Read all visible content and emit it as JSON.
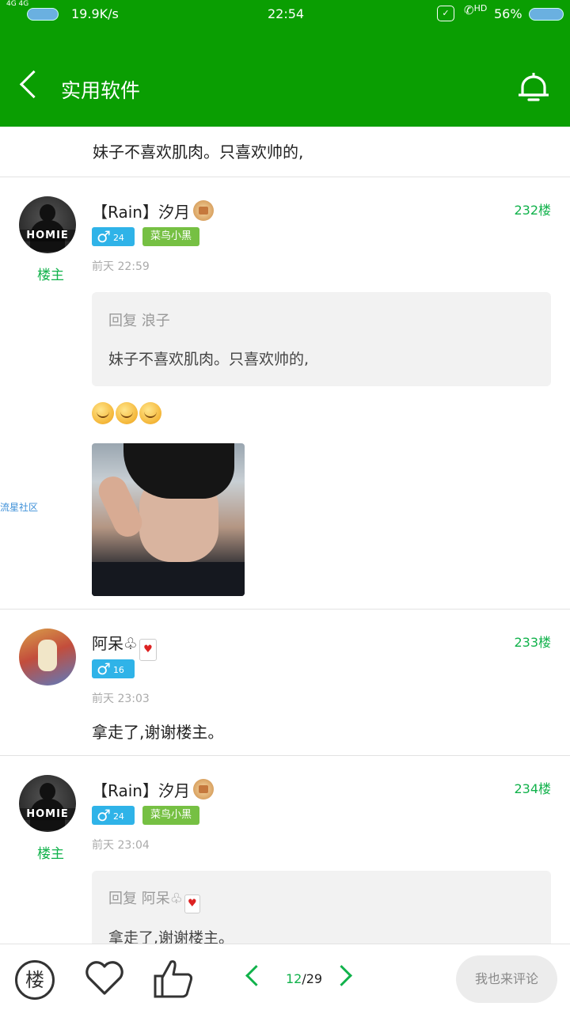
{
  "status_bar": {
    "network": "4G 4G",
    "speed": "19.9K/s",
    "time": "22:54",
    "hd": "HD",
    "battery": "56%"
  },
  "header": {
    "title": "实用软件",
    "bg_color": "#0a9e02"
  },
  "top_snippet": "妹子不喜欢肌肉。只喜欢帅的,",
  "posts": [
    {
      "user": "【Rain】汐月",
      "owner_label": "楼主",
      "gender_age": "24",
      "level": "菜鸟小黑",
      "time": "前天 22:59",
      "floor": "232楼",
      "quote": {
        "head": "回复 浪子",
        "body": "妹子不喜欢肌肉。只喜欢帅的,"
      },
      "emoji_count": 3,
      "avatar_text": "HOMIE"
    },
    {
      "user": "阿呆♧",
      "gender_age": "16",
      "time": "前天 23:03",
      "floor": "233楼",
      "text": "拿走了,谢谢楼主。"
    },
    {
      "user": "【Rain】汐月",
      "owner_label": "楼主",
      "gender_age": "24",
      "level": "菜鸟小黑",
      "time": "前天 23:04",
      "floor": "234楼",
      "quote": {
        "head": "回复 阿呆♧",
        "body": "拿走了,谢谢楼主。"
      },
      "avatar_text": "HOMIE"
    }
  ],
  "watermark": "流星社区",
  "footer": {
    "floor_button": "楼",
    "page_current": "12",
    "page_total": "/29",
    "comment_button": "我也来评论"
  },
  "icons": [
    "back-icon",
    "bell-icon",
    "floor-icon",
    "heart-icon",
    "thumbs-up-icon",
    "prev-page-icon",
    "next-page-icon"
  ],
  "accent_color": "#11b24b"
}
